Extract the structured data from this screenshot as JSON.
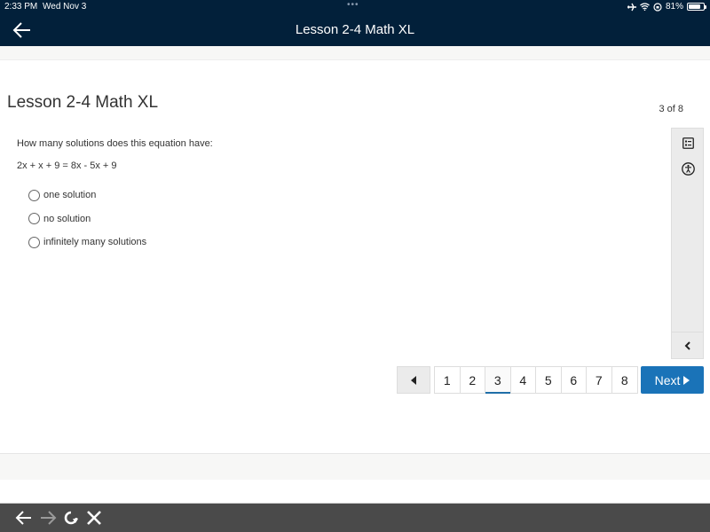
{
  "status_bar": {
    "time": "2:33 PM",
    "date": "Wed Nov 3",
    "dots": "•••",
    "battery_percent": "81%",
    "battery_level": 0.81,
    "icons": [
      "airplane-icon",
      "wifi-icon",
      "orientation-lock-icon",
      "battery-icon"
    ]
  },
  "nav": {
    "title": "Lesson 2-4 Math XL",
    "back_icon": "back-arrow-icon"
  },
  "lesson": {
    "title": "Lesson 2-4 Math XL",
    "count": "3 of 8"
  },
  "question": {
    "prompt": "How many solutions does this equation have:",
    "equation": "2x + x + 9 = 8x - 5x + 9",
    "options": [
      {
        "label": "one solution",
        "selected": false
      },
      {
        "label": "no solution",
        "selected": false
      },
      {
        "label": "infinitely many solutions",
        "selected": false
      }
    ]
  },
  "side_tools": {
    "items": [
      "calculator-list-icon",
      "accessibility-icon"
    ],
    "collapse_icon": "chevron-left-icon"
  },
  "pager": {
    "pages": [
      "1",
      "2",
      "3",
      "4",
      "5",
      "6",
      "7",
      "8"
    ],
    "current": "3",
    "next_label": "Next"
  },
  "colors": {
    "header_bg": "#02203a",
    "accent": "#1a73b8",
    "browser_bar": "#4a4a4a"
  }
}
